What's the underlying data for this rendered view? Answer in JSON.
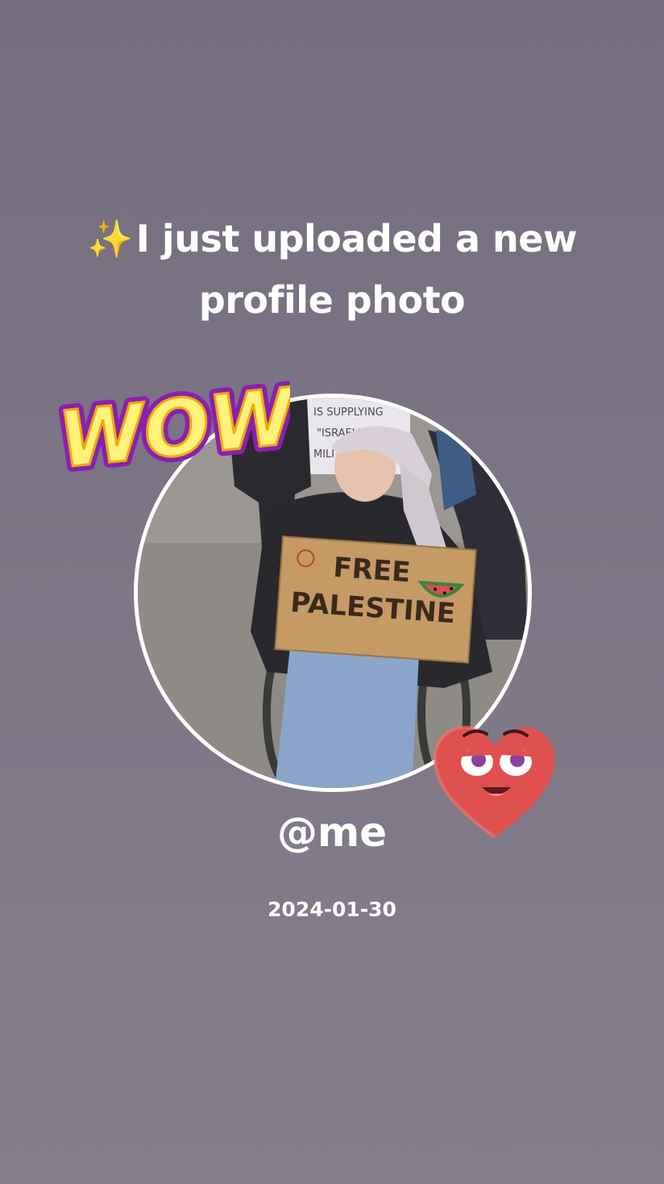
{
  "headline": {
    "icon": "sparkles-icon",
    "icon_glyph": "✨",
    "text_line1": "I just uploaded a new",
    "text_line2": "profile photo"
  },
  "profile_photo": {
    "sign_main_line1": "FREE",
    "sign_main_line2": "PALESTINE",
    "sign_bg_line1": "IS SUPPLYING",
    "sign_bg_line2": "\"ISRAEL\" WITH",
    "sign_bg_line3": "MILITARY"
  },
  "stickers": {
    "wow_text": "WOW!",
    "heart": "heart-face-icon"
  },
  "user": {
    "handle": "@me",
    "date": "2024-01-30"
  },
  "colors": {
    "background": "#7a7484",
    "text": "#ffffff",
    "wow_fill": "#fff27a",
    "wow_outline": "#8a1fb8",
    "heart": "#e0504f"
  }
}
